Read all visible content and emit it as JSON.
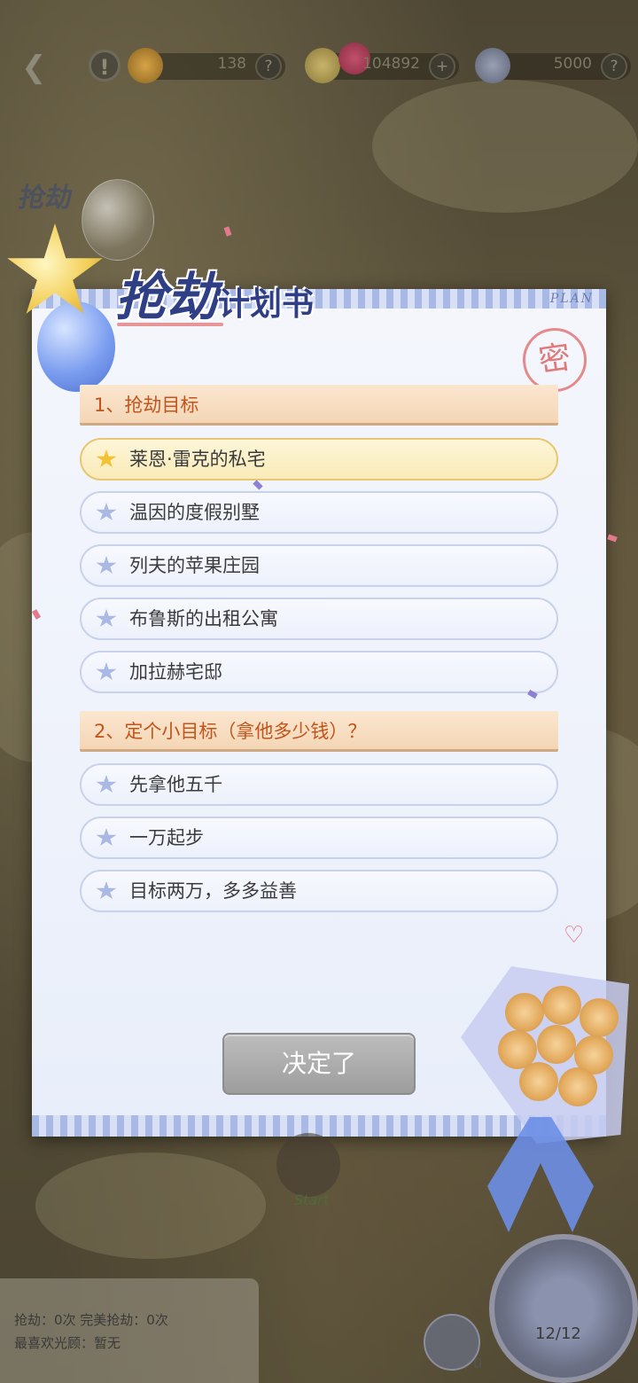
{
  "topbar": {
    "resources": [
      {
        "value": "138",
        "button": "?"
      },
      {
        "value": "104892",
        "button": "+"
      },
      {
        "value": "5000",
        "button": "?"
      }
    ],
    "alert_glyph": "!"
  },
  "card": {
    "title_main": "抢劫",
    "title_sub": "计划书",
    "plan_label": "PLAN",
    "stamp": "密",
    "sections": [
      {
        "header": "1、抢劫目标",
        "options": [
          "莱恩·雷克的私宅",
          "温因的度假别墅",
          "列夫的苹果庄园",
          "布鲁斯的出租公寓",
          "加拉赫宅邸"
        ],
        "selected_index": 0
      },
      {
        "header": "2、定个小目标（拿他多少钱）？",
        "options": [
          "先拿他五千",
          "一万起步",
          "目标两万，多多益善"
        ],
        "selected_index": -1
      }
    ],
    "decide_button": "决定了"
  },
  "sticker": "抢劫",
  "stats": {
    "line1": "抢劫：0次  完美抢劫：0次",
    "line2": "最喜欢光顾：暂无"
  },
  "feather_count": "0",
  "progress_text": "12/12",
  "start_label": "Start",
  "colors": {
    "section_text": "#c2541c",
    "selected_star": "#f2c233",
    "title": "#2f3f86"
  }
}
